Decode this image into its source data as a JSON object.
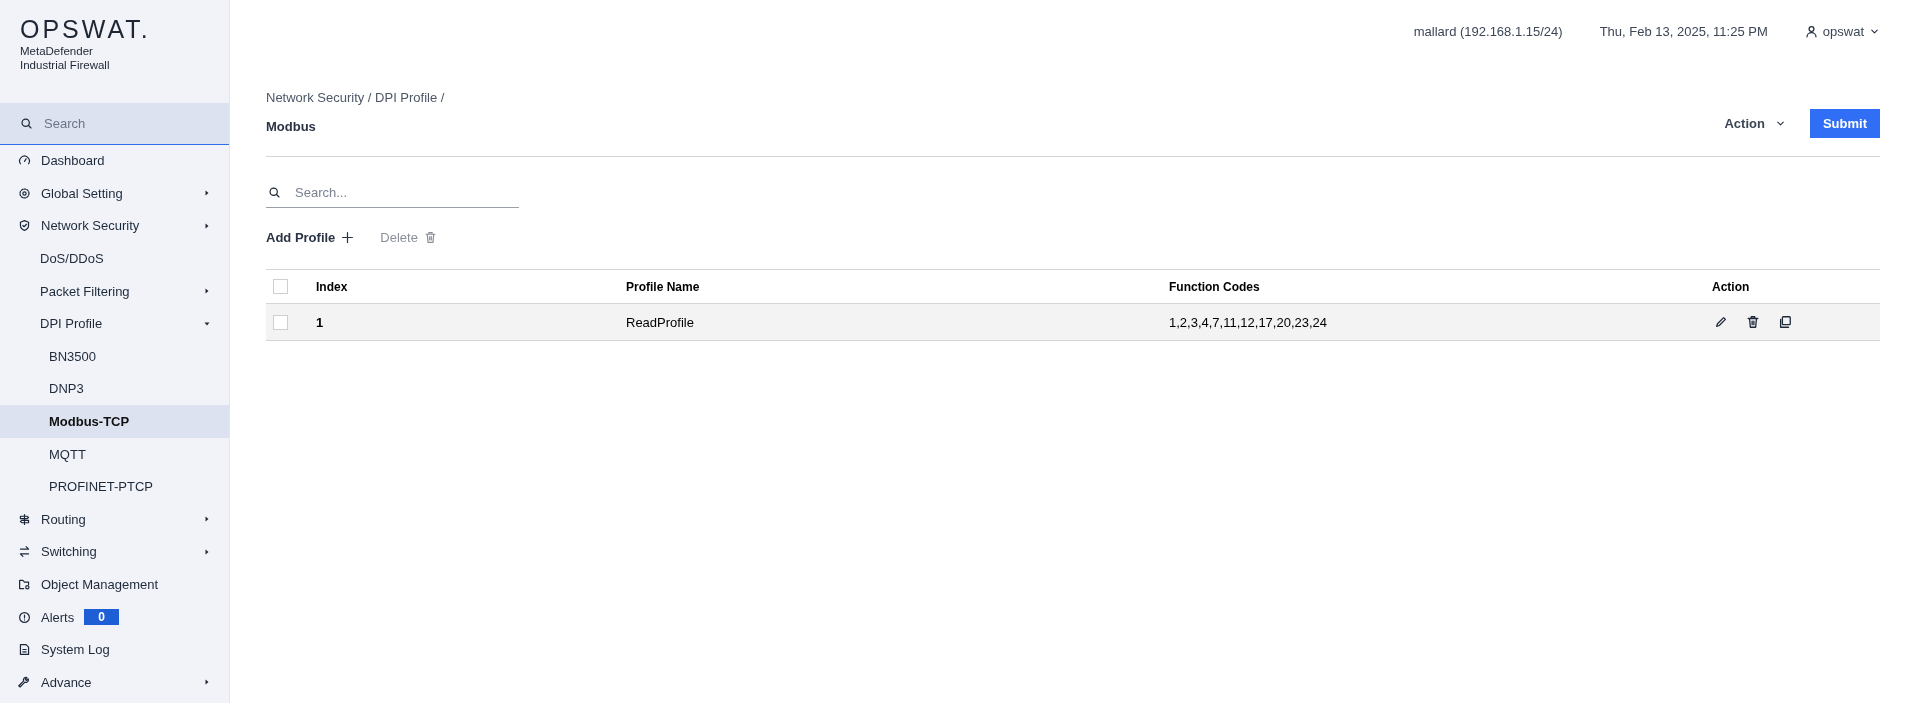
{
  "brand": {
    "logo": "OPSWAT.",
    "product_line_1": "MetaDefender",
    "product_line_2": "Industrial Firewall"
  },
  "sidebar": {
    "search": {
      "placeholder": "Search"
    },
    "items": [
      {
        "label": "Dashboard",
        "selected": false
      },
      {
        "label": "Global Setting",
        "expanded": false,
        "selected": false
      },
      {
        "label": "Network Security",
        "expanded": false,
        "selected": false,
        "children": [
          {
            "label": "DoS/DDoS",
            "selected": false
          },
          {
            "label": "Packet Filtering",
            "expanded": false,
            "selected": false
          },
          {
            "label": "DPI Profile",
            "expanded": true,
            "selected": false,
            "children": [
              {
                "label": "BN3500",
                "selected": false
              },
              {
                "label": "DNP3",
                "selected": false
              },
              {
                "label": "Modbus-TCP",
                "selected": true
              },
              {
                "label": "MQTT",
                "selected": false
              },
              {
                "label": "PROFINET-PTCP",
                "selected": false
              }
            ]
          }
        ]
      },
      {
        "label": "Routing",
        "expanded": false,
        "selected": false
      },
      {
        "label": "Switching",
        "expanded": false,
        "selected": false
      },
      {
        "label": "Object Management",
        "selected": false
      },
      {
        "label": "Alerts",
        "badge": "0",
        "selected": false
      },
      {
        "label": "System Log",
        "selected": false
      },
      {
        "label": "Advance",
        "expanded": false,
        "selected": false
      }
    ]
  },
  "top_bar": {
    "host": "mallard (192.168.1.15/24)",
    "datetime": "Thu, Feb 13, 2025, 11:25 PM",
    "user": "opswat"
  },
  "page": {
    "breadcrumb": "Network Security / DPI Profile /",
    "title": "Modbus",
    "action_menu": "Action",
    "submit": "Submit"
  },
  "search": {
    "placeholder": "Search..."
  },
  "toolbar": {
    "add": "Add Profile",
    "delete": "Delete"
  },
  "table": {
    "columns": [
      "Index",
      "Profile Name",
      "Function Codes",
      "Action"
    ],
    "header_checked": false,
    "rows": [
      {
        "checked": false,
        "index": "1",
        "profile_name": "ReadProfile",
        "function_codes": "1,2,3,4,7,11,12,17,20,23,24"
      }
    ]
  }
}
